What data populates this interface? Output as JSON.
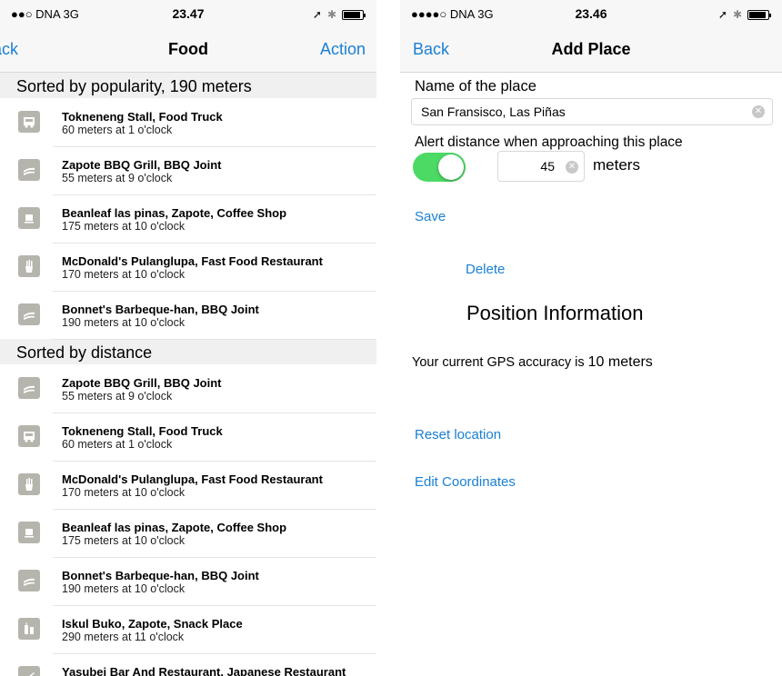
{
  "left": {
    "status": {
      "carrier": "●●○ DNA  3G",
      "time": "23.47"
    },
    "nav": {
      "back": "ack",
      "title": "Food",
      "action": "Action"
    },
    "sections": [
      {
        "header": "Sorted by popularity, 190 meters",
        "rows": [
          {
            "icon": "food-truck-icon",
            "name": "Tokneneng Stall, Food Truck",
            "detail": "60 meters at 1 o'clock"
          },
          {
            "icon": "bbq-icon",
            "name": "Zapote BBQ Grill, BBQ Joint",
            "detail": "55 meters at 9 o'clock"
          },
          {
            "icon": "coffee-icon",
            "name": "Beanleaf las pinas, Zapote, Coffee Shop",
            "detail": "175 meters at 10 o'clock"
          },
          {
            "icon": "fries-icon",
            "name": "McDonald's Pulanglupa, Fast Food Restaurant",
            "detail": "170 meters at 10 o'clock"
          },
          {
            "icon": "bbq-icon",
            "name": "Bonnet's Barbeque-han, BBQ Joint",
            "detail": "190 meters at 10 o'clock"
          }
        ]
      },
      {
        "header": "Sorted by distance",
        "rows": [
          {
            "icon": "bbq-icon",
            "name": "Zapote BBQ Grill, BBQ Joint",
            "detail": "55 meters at 9 o'clock"
          },
          {
            "icon": "food-truck-icon",
            "name": "Tokneneng Stall, Food Truck",
            "detail": "60 meters at 1 o'clock"
          },
          {
            "icon": "fries-icon",
            "name": "McDonald's Pulanglupa, Fast Food Restaurant",
            "detail": "170 meters at 10 o'clock"
          },
          {
            "icon": "coffee-icon",
            "name": "Beanleaf las pinas, Zapote, Coffee Shop",
            "detail": "175 meters at 10 o'clock"
          },
          {
            "icon": "bbq-icon",
            "name": "Bonnet's Barbeque-han, BBQ Joint",
            "detail": "190 meters at 10 o'clock"
          },
          {
            "icon": "snack-icon",
            "name": "Iskul Buko, Zapote, Snack Place",
            "detail": "290 meters at 11 o'clock"
          },
          {
            "icon": "sushi-icon",
            "name": "Yasubei Bar And Restaurant, Japanese Restaurant",
            "detail": ""
          }
        ]
      }
    ]
  },
  "right": {
    "status": {
      "carrier": "●●●●○ DNA  3G",
      "time": "23.46"
    },
    "nav": {
      "back": "Back",
      "title": "Add Place"
    },
    "name_label": "Name of the place",
    "name_value": "San Fransisco, Las Piñas",
    "alert_label": "Alert distance when approaching this place",
    "alert_enabled": true,
    "alert_distance": "45",
    "alert_unit": "meters",
    "save": "Save",
    "delete": "Delete",
    "position_heading": "Position Information",
    "gps_text": "Your current GPS accuracy is",
    "gps_value": "10 meters",
    "reset_location": "Reset location",
    "edit_coordinates": "Edit Coordinates"
  },
  "colors": {
    "accent": "#1a7fd4",
    "toggle_on": "#4cd964",
    "icon_tile": "#b5b4ad"
  }
}
